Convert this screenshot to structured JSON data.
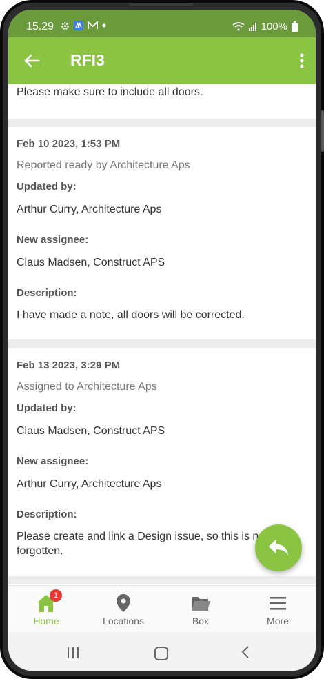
{
  "statusbar": {
    "time": "15.29",
    "battery": "100%"
  },
  "appbar": {
    "title": "RFI3"
  },
  "previous_card": {
    "text": "Please make sure to include all doors."
  },
  "entries": [
    {
      "date": "Feb 10 2023, 1:53 PM",
      "status": "Reported ready by Architecture Aps",
      "updated_by_label": "Updated by:",
      "updated_by": "Arthur Curry, Architecture Aps",
      "assignee_label": "New assignee:",
      "assignee": "Claus Madsen, Construct APS",
      "description_label": "Description:",
      "description": "I have made a note, all doors will be corrected."
    },
    {
      "date": "Feb 13 2023, 3:29 PM",
      "status": "Assigned to Architecture Aps",
      "updated_by_label": "Updated by:",
      "updated_by": "Claus Madsen, Construct APS",
      "assignee_label": "New assignee:",
      "assignee": "Arthur Curry, Architecture Aps",
      "description_label": "Description:",
      "description": "Please create and link a Design issue, so this is not forgotten."
    }
  ],
  "bottom_nav": {
    "items": [
      {
        "label": "Home",
        "icon": "home-icon",
        "badge": "1"
      },
      {
        "label": "Locations",
        "icon": "location-pin-icon"
      },
      {
        "label": "Box",
        "icon": "folder-icon"
      },
      {
        "label": "More",
        "icon": "hamburger-menu-icon"
      }
    ]
  },
  "colors": {
    "accent": "#8bc443",
    "status_bar": "#6a9a3b",
    "badge": "#e53935"
  }
}
